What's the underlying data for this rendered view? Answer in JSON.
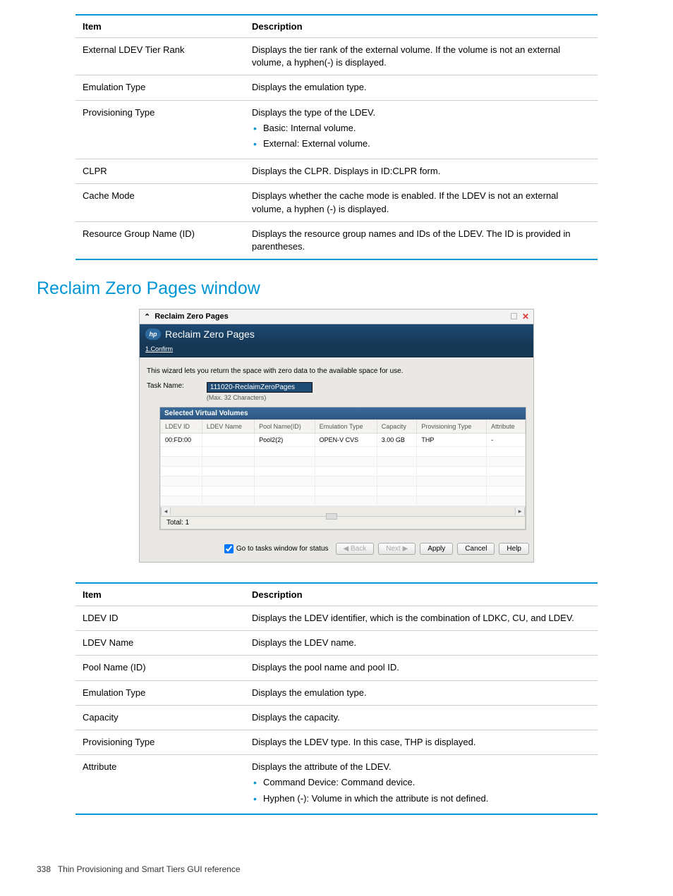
{
  "table1": {
    "head_item": "Item",
    "head_desc": "Description",
    "rows": [
      {
        "item": "External LDEV Tier Rank",
        "desc": "Displays the tier rank of the external volume. If the volume is not an external volume, a hyphen(-) is displayed."
      },
      {
        "item": "Emulation Type",
        "desc": "Displays the emulation type."
      },
      {
        "item": "Provisioning Type",
        "desc": "Displays the type of the LDEV.",
        "bullets": [
          "Basic: Internal volume.",
          "External: External volume."
        ]
      },
      {
        "item": "CLPR",
        "desc": "Displays the CLPR. Displays in ID:CLPR form."
      },
      {
        "item": "Cache Mode",
        "desc": "Displays whether the cache mode is enabled. If the LDEV is not an external volume, a hyphen (-) is displayed."
      },
      {
        "item": "Resource Group Name (ID)",
        "desc": "Displays the resource group names and IDs of the LDEV. The ID is provided in parentheses."
      }
    ]
  },
  "section_title": "Reclaim Zero Pages window",
  "wizard": {
    "title": "Reclaim Zero Pages",
    "header": "Reclaim Zero Pages",
    "step": "1.Confirm",
    "intro": "This wizard lets you return the space with zero data to the available space for use.",
    "task_label": "Task Name:",
    "task_value": "111020-ReclaimZeroPages",
    "task_hint": "(Max. 32 Characters)",
    "svv_title": "Selected Virtual Volumes",
    "columns": [
      "LDEV ID",
      "LDEV Name",
      "Pool Name(ID)",
      "Emulation Type",
      "Capacity",
      "Provisioning Type",
      "Attribute"
    ],
    "row": {
      "ldev_id": "00:FD:00",
      "ldev_name": "",
      "pool": "Pool2(2)",
      "emu": "OPEN-V CVS",
      "cap": "3.00 GB",
      "prov": "THP",
      "attr": "-"
    },
    "total": "Total: 1",
    "checkbox": "Go to tasks window for status",
    "btn_back": "◀ Back",
    "btn_next": "Next ▶",
    "btn_apply": "Apply",
    "btn_cancel": "Cancel",
    "btn_help": "Help"
  },
  "table2": {
    "head_item": "Item",
    "head_desc": "Description",
    "rows": [
      {
        "item": "LDEV ID",
        "desc": "Displays the LDEV identifier, which is the combination of LDKC, CU, and LDEV."
      },
      {
        "item": "LDEV Name",
        "desc": "Displays the LDEV name."
      },
      {
        "item": "Pool Name (ID)",
        "desc": "Displays the pool name and pool ID."
      },
      {
        "item": "Emulation Type",
        "desc": "Displays the emulation type."
      },
      {
        "item": "Capacity",
        "desc": "Displays the capacity."
      },
      {
        "item": "Provisioning Type",
        "desc": "Displays the LDEV type. In this case, THP is displayed."
      },
      {
        "item": "Attribute",
        "desc": "Displays the attribute of the LDEV.",
        "bullets": [
          "Command Device: Command device.",
          "Hyphen (-): Volume in which the attribute is not defined."
        ]
      }
    ]
  },
  "footer": {
    "page": "338",
    "text": "Thin Provisioning and Smart Tiers GUI reference"
  }
}
